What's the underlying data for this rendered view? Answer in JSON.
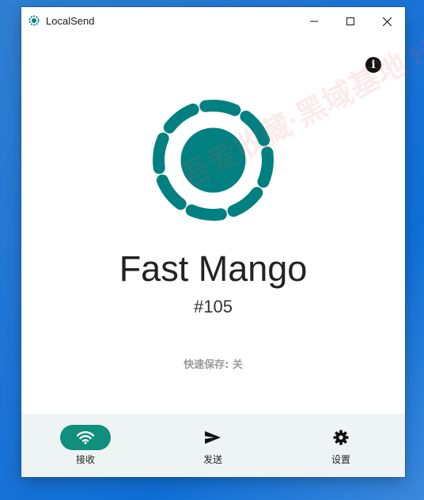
{
  "window": {
    "title": "LocalSend",
    "accent": "#008080"
  },
  "main": {
    "device_name": "Fast Mango",
    "device_id": "#105",
    "quick_save": "快速保存: 关"
  },
  "watermark": {
    "text": "吾爱收藏·黑域基地  Hybase.com"
  },
  "nav": {
    "items": [
      {
        "label": "接收",
        "icon": "wifi-icon",
        "active": true
      },
      {
        "label": "发送",
        "icon": "send-icon",
        "active": false
      },
      {
        "label": "设置",
        "icon": "gear-icon",
        "active": false
      }
    ],
    "active_color": "#0f8f7c"
  }
}
